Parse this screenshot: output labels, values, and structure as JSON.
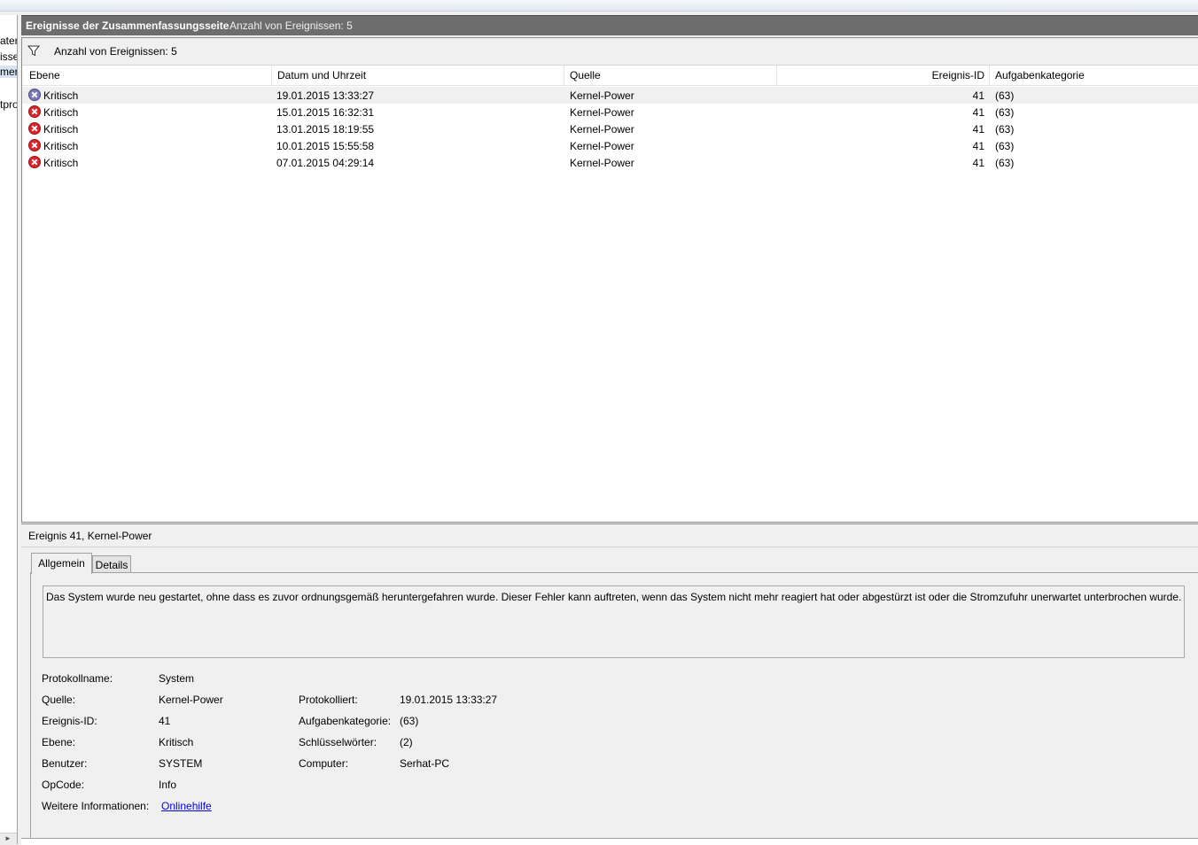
{
  "left_pane": {
    "fragments": [
      "ater",
      "isse",
      "mer",
      "tpro"
    ]
  },
  "header": {
    "title": "Ereignisse der Zusammenfassungsseite",
    "count": "Anzahl von Ereignissen: 5"
  },
  "filter": {
    "text": "Anzahl von Ereignissen: 5"
  },
  "columns": [
    "Ebene",
    "Datum und Uhrzeit",
    "Quelle",
    "Ereignis-ID",
    "Aufgabenkategorie"
  ],
  "rows": [
    {
      "level": "Kritisch",
      "datetime": "19.01.2015 13:33:27",
      "source": "Kernel-Power",
      "id": "41",
      "category": "(63)"
    },
    {
      "level": "Kritisch",
      "datetime": "15.01.2015 16:32:31",
      "source": "Kernel-Power",
      "id": "41",
      "category": "(63)"
    },
    {
      "level": "Kritisch",
      "datetime": "13.01.2015 18:19:55",
      "source": "Kernel-Power",
      "id": "41",
      "category": "(63)"
    },
    {
      "level": "Kritisch",
      "datetime": "10.01.2015 15:55:58",
      "source": "Kernel-Power",
      "id": "41",
      "category": "(63)"
    },
    {
      "level": "Kritisch",
      "datetime": "07.01.2015 04:29:14",
      "source": "Kernel-Power",
      "id": "41",
      "category": "(63)"
    }
  ],
  "detail": {
    "title": "Ereignis 41, Kernel-Power",
    "tabs": [
      "Allgemein",
      "Details"
    ],
    "description": "Das System wurde neu gestartet, ohne dass es zuvor ordnungsgemäß heruntergefahren wurde. Dieser Fehler kann auftreten, wenn das System nicht mehr reagiert hat oder abgestürzt ist oder die Stromzufuhr unerwartet unterbrochen wurde.",
    "protokollname_label": "Protokollname:",
    "protokollname": "System",
    "quelle_label": "Quelle:",
    "quelle": "Kernel-Power",
    "protokolliert_label": "Protokolliert:",
    "protokolliert": "19.01.2015 13:33:27",
    "ereignisid_label": "Ereignis-ID:",
    "ereignisid": "41",
    "aufgabenkategorie_label": "Aufgabenkategorie:",
    "aufgabenkategorie": "(63)",
    "ebene_label": "Ebene:",
    "ebene": "Kritisch",
    "schluesselwoerter_label": "Schlüsselwörter:",
    "schluesselwoerter": "(2)",
    "benutzer_label": "Benutzer:",
    "benutzer": "SYSTEM",
    "computer_label": "Computer:",
    "computer": "Serhat-PC",
    "opcode_label": "OpCode:",
    "opcode": "Info",
    "weitere_label": "Weitere Informationen:",
    "weitere_link": "Onlinehilfe"
  },
  "colors": {
    "header_bg": "#6d6d6d",
    "critical_icon": "#d9262c",
    "link": "#0000ee"
  }
}
